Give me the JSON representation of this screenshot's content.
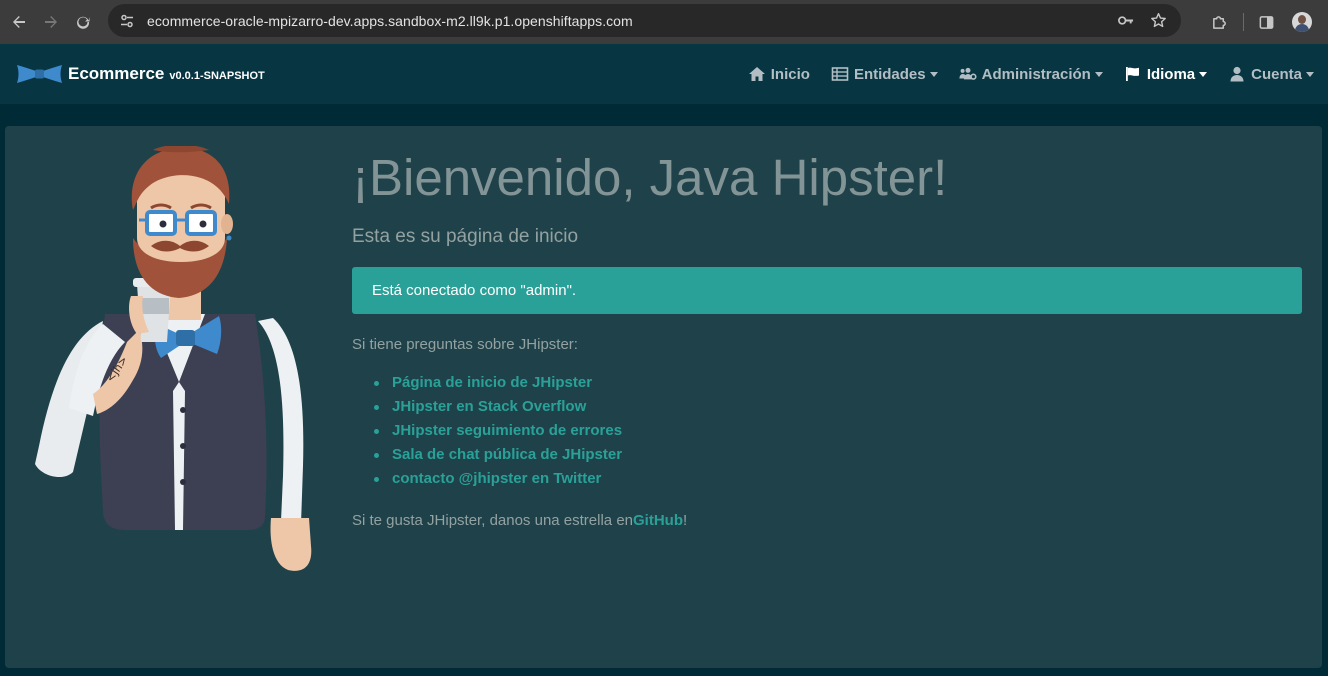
{
  "browser": {
    "url": "ecommerce-oracle-mpizarro-dev.apps.sandbox-m2.ll9k.p1.openshiftapps.com"
  },
  "navbar": {
    "brand_title": "Ecommerce",
    "brand_version": "v0.0.1-SNAPSHOT",
    "items": [
      {
        "label": "Inicio",
        "icon": "home-icon",
        "dropdown": false
      },
      {
        "label": "Entidades",
        "icon": "th-list-icon",
        "dropdown": true
      },
      {
        "label": "Administración",
        "icon": "users-cog-icon",
        "dropdown": true
      },
      {
        "label": "Idioma",
        "icon": "flag-icon",
        "dropdown": true
      },
      {
        "label": "Cuenta",
        "icon": "user-icon",
        "dropdown": true
      }
    ]
  },
  "main": {
    "heading": "¡Bienvenido, Java Hipster!",
    "subheading": "Esta es su página de inicio",
    "alert": "Está conectado como \"admin\".",
    "question": "Si tiene preguntas sobre JHipster:",
    "links": [
      "Página de inicio de JHipster",
      "JHipster en Stack Overflow",
      "JHipster seguimiento de errores",
      "Sala de chat pública de JHipster",
      "contacto @jhipster en Twitter"
    ],
    "star_prefix": "Si te gusta JHipster, danos una estrella en",
    "star_link": "GitHub",
    "star_suffix": "!",
    "mascot_tattoo": "<jh>"
  },
  "colors": {
    "navbar_bg": "#073642",
    "page_bg": "#002b36",
    "card_bg": "#1f424a",
    "accent": "#2aa198",
    "muted_text": "#93a1a1",
    "heading_text": "#839496"
  }
}
